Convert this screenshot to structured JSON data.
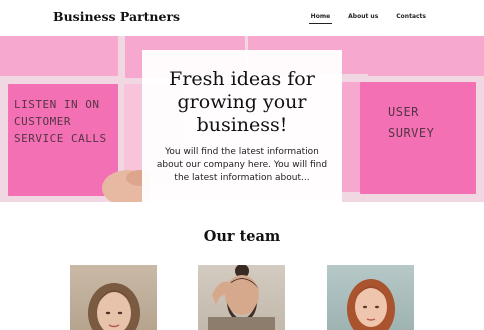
{
  "header": {
    "brand": "Business Partners",
    "nav": [
      {
        "label": "Home",
        "active": true
      },
      {
        "label": "About us",
        "active": false
      },
      {
        "label": "Contacts",
        "active": false
      }
    ]
  },
  "hero": {
    "title": "Fresh ideas for growing your business!",
    "text": "You will find the latest information about our company here. You will find the latest information about...",
    "background_notes": [
      "LISTEN IN ON\nCUSTOMER\nSERVICE CALLS",
      "USER\nSURVEY"
    ]
  },
  "team": {
    "title": "Our team",
    "members": [
      {
        "photo": "woman-portrait"
      },
      {
        "photo": "man-portrait"
      },
      {
        "photo": "redhead-woman-portrait"
      }
    ]
  },
  "colors": {
    "note_pink": "#f470b4",
    "note_light": "#f6a8cf",
    "card_bg": "#ffffff"
  }
}
